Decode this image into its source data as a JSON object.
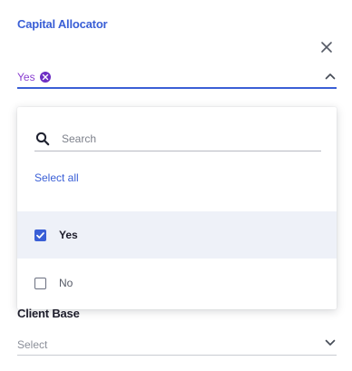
{
  "fields": {
    "capital_allocator": {
      "label": "Capital Allocator",
      "selected_chip": "Yes",
      "dropdown": {
        "search_placeholder": "Search",
        "select_all_label": "Select all",
        "options": [
          {
            "label": "Yes",
            "checked": true
          },
          {
            "label": "No",
            "checked": false
          }
        ]
      }
    },
    "client_base": {
      "label": "Client Base",
      "placeholder": "Select"
    }
  },
  "colors": {
    "accent": "#3a5fd6",
    "chip_text": "#8a3fd1",
    "selected_row_bg": "#eef1f8"
  },
  "icons": {
    "clear": "close-icon",
    "collapse": "chevron-up-icon",
    "expand": "chevron-down-icon",
    "search": "search-icon",
    "chip_remove": "remove-chip-icon"
  }
}
